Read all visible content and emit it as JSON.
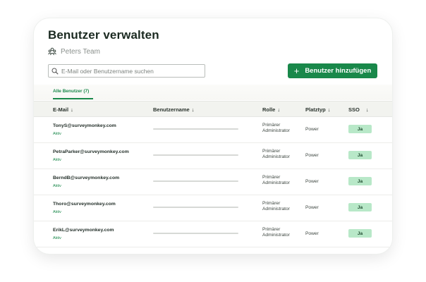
{
  "page_title": "Benutzer verwalten",
  "team": {
    "label": "Peters Team",
    "icon": "team-icon"
  },
  "search": {
    "placeholder": "E-Mail oder Benutzername suchen",
    "value": ""
  },
  "add_button": {
    "label": "Benutzer hinzufügen",
    "icon": "plus-icon"
  },
  "tabs": [
    {
      "label": "Alle Benutzer (7)",
      "active": true
    }
  ],
  "columns": {
    "email": "E-Mail",
    "username": "Benutzername",
    "role": "Rolle",
    "plan": "Platztyp",
    "sso": "SSO"
  },
  "sort_arrow": "↓",
  "rows": [
    {
      "email": "TonyS@surveymonkey.com",
      "status": "Aktiv",
      "role_line1": "Primärer",
      "role_line2": "Administrator",
      "plan": "Power",
      "sso": "Ja"
    },
    {
      "email": "PetraParker@surveymonkey.com",
      "status": "Aktiv",
      "role_line1": "Primärer",
      "role_line2": "Administrator",
      "plan": "Power",
      "sso": "Ja"
    },
    {
      "email": "BerndB@surveymonkey.com",
      "status": "Aktiv",
      "role_line1": "Primärer",
      "role_line2": "Administrator",
      "plan": "Power",
      "sso": "Ja"
    },
    {
      "email": "Thoro@surveymonkey.com",
      "status": "Aktiv",
      "role_line1": "Primärer",
      "role_line2": "Administrator",
      "plan": "Power",
      "sso": "Ja"
    },
    {
      "email": "ErikL@surveymonkey.com",
      "status": "Aktiv",
      "role_line1": "Primärer",
      "role_line2": "Administrator",
      "plan": "Power",
      "sso": "Ja"
    }
  ],
  "colors": {
    "brand_green": "#19884a",
    "sso_badge": "#b8e8c8",
    "header_bg": "#f2f3ef"
  }
}
